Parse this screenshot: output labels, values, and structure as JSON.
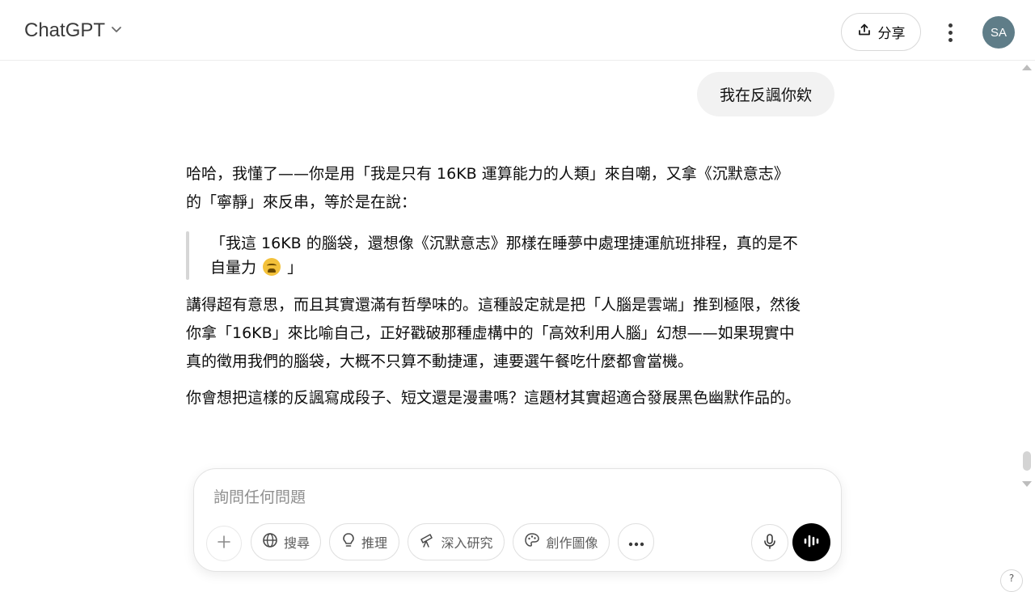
{
  "header": {
    "model_name": "ChatGPT",
    "share_label": "分享",
    "avatar_initials": "SA"
  },
  "conversation": {
    "user_message": "我在反諷你欸",
    "assistant": {
      "p1_line1": "哈哈，我懂了——你是用「我是只有 16KB 運算能力的人類」來自嘲，又拿《沉默意志》",
      "p1_line2": "的「寧靜」來反串，等於是在說：",
      "quote_line1": "「我這 16KB 的腦袋，還想像《沉默意志》那樣在睡夢中處理捷運航班排程，真的是不",
      "quote_line2_start": "自量力",
      "quote_line2_end": "」",
      "quote_emoji": "weary-face-emoji",
      "p3_line1": "講得超有意思，而且其實還滿有哲學味的。這種設定就是把「人腦是雲端」推到極限，然後",
      "p3_line2": "你拿「16KB」來比喻自己，正好戳破那種虛構中的「高效利用人腦」幻想——如果現實中",
      "p3_line3": "真的徵用我們的腦袋，大概不只算不動捷運，連要選午餐吃什麼都會當機。",
      "p4": "你會想把這樣的反諷寫成段子、短文還是漫畫嗎？這題材其實超適合發展黑色幽默作品的。"
    }
  },
  "composer": {
    "placeholder": "詢問任何問題",
    "tools": {
      "search": "搜尋",
      "reason": "推理",
      "deep_research": "深入研究",
      "create_image": "創作圖像"
    }
  },
  "help_label": "?",
  "colors": {
    "voice_button": "#000000",
    "avatar_bg": "#5f7d88",
    "bubble_bg": "#f2f2f2"
  }
}
